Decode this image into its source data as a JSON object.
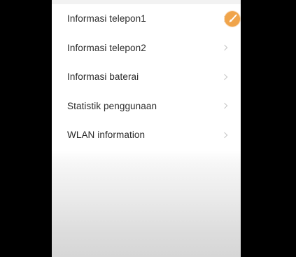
{
  "menu": {
    "items": [
      {
        "label": "Informasi telepon1",
        "icon": "chevron-right-icon"
      },
      {
        "label": "Informasi telepon2",
        "icon": "chevron-right-icon"
      },
      {
        "label": "Informasi baterai",
        "icon": "chevron-right-icon"
      },
      {
        "label": "Statistik penggunaan",
        "icon": "chevron-right-icon"
      },
      {
        "label": "WLAN information",
        "icon": "chevron-right-icon"
      }
    ]
  },
  "floating_ball": {
    "icon": "paintbrush-icon",
    "color": "#f0a44a"
  },
  "colors": {
    "background": "#ffffff",
    "text": "#2b2b2b",
    "chevron": "#c4c4c4",
    "letterbox": "#000000"
  }
}
